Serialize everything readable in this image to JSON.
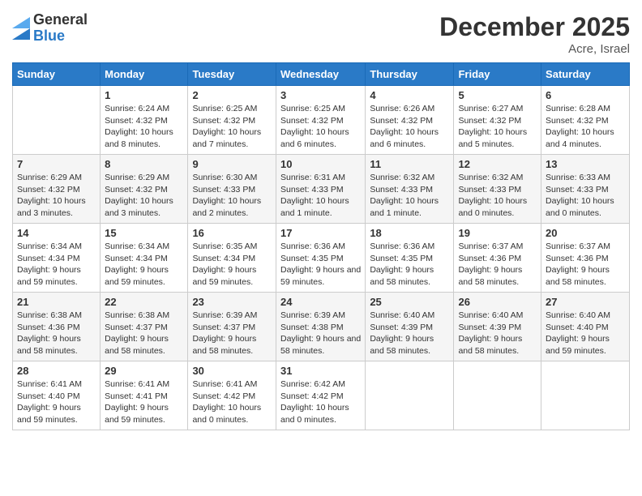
{
  "logo": {
    "general": "General",
    "blue": "Blue"
  },
  "header": {
    "month": "December 2025",
    "location": "Acre, Israel"
  },
  "days_of_week": [
    "Sunday",
    "Monday",
    "Tuesday",
    "Wednesday",
    "Thursday",
    "Friday",
    "Saturday"
  ],
  "weeks": [
    [
      {
        "day": "",
        "sunrise": "",
        "sunset": "",
        "daylight": ""
      },
      {
        "day": "1",
        "sunrise": "Sunrise: 6:24 AM",
        "sunset": "Sunset: 4:32 PM",
        "daylight": "Daylight: 10 hours and 8 minutes."
      },
      {
        "day": "2",
        "sunrise": "Sunrise: 6:25 AM",
        "sunset": "Sunset: 4:32 PM",
        "daylight": "Daylight: 10 hours and 7 minutes."
      },
      {
        "day": "3",
        "sunrise": "Sunrise: 6:25 AM",
        "sunset": "Sunset: 4:32 PM",
        "daylight": "Daylight: 10 hours and 6 minutes."
      },
      {
        "day": "4",
        "sunrise": "Sunrise: 6:26 AM",
        "sunset": "Sunset: 4:32 PM",
        "daylight": "Daylight: 10 hours and 6 minutes."
      },
      {
        "day": "5",
        "sunrise": "Sunrise: 6:27 AM",
        "sunset": "Sunset: 4:32 PM",
        "daylight": "Daylight: 10 hours and 5 minutes."
      },
      {
        "day": "6",
        "sunrise": "Sunrise: 6:28 AM",
        "sunset": "Sunset: 4:32 PM",
        "daylight": "Daylight: 10 hours and 4 minutes."
      }
    ],
    [
      {
        "day": "7",
        "sunrise": "Sunrise: 6:29 AM",
        "sunset": "Sunset: 4:32 PM",
        "daylight": "Daylight: 10 hours and 3 minutes."
      },
      {
        "day": "8",
        "sunrise": "Sunrise: 6:29 AM",
        "sunset": "Sunset: 4:32 PM",
        "daylight": "Daylight: 10 hours and 3 minutes."
      },
      {
        "day": "9",
        "sunrise": "Sunrise: 6:30 AM",
        "sunset": "Sunset: 4:33 PM",
        "daylight": "Daylight: 10 hours and 2 minutes."
      },
      {
        "day": "10",
        "sunrise": "Sunrise: 6:31 AM",
        "sunset": "Sunset: 4:33 PM",
        "daylight": "Daylight: 10 hours and 1 minute."
      },
      {
        "day": "11",
        "sunrise": "Sunrise: 6:32 AM",
        "sunset": "Sunset: 4:33 PM",
        "daylight": "Daylight: 10 hours and 1 minute."
      },
      {
        "day": "12",
        "sunrise": "Sunrise: 6:32 AM",
        "sunset": "Sunset: 4:33 PM",
        "daylight": "Daylight: 10 hours and 0 minutes."
      },
      {
        "day": "13",
        "sunrise": "Sunrise: 6:33 AM",
        "sunset": "Sunset: 4:33 PM",
        "daylight": "Daylight: 10 hours and 0 minutes."
      }
    ],
    [
      {
        "day": "14",
        "sunrise": "Sunrise: 6:34 AM",
        "sunset": "Sunset: 4:34 PM",
        "daylight": "Daylight: 9 hours and 59 minutes."
      },
      {
        "day": "15",
        "sunrise": "Sunrise: 6:34 AM",
        "sunset": "Sunset: 4:34 PM",
        "daylight": "Daylight: 9 hours and 59 minutes."
      },
      {
        "day": "16",
        "sunrise": "Sunrise: 6:35 AM",
        "sunset": "Sunset: 4:34 PM",
        "daylight": "Daylight: 9 hours and 59 minutes."
      },
      {
        "day": "17",
        "sunrise": "Sunrise: 6:36 AM",
        "sunset": "Sunset: 4:35 PM",
        "daylight": "Daylight: 9 hours and 59 minutes."
      },
      {
        "day": "18",
        "sunrise": "Sunrise: 6:36 AM",
        "sunset": "Sunset: 4:35 PM",
        "daylight": "Daylight: 9 hours and 58 minutes."
      },
      {
        "day": "19",
        "sunrise": "Sunrise: 6:37 AM",
        "sunset": "Sunset: 4:36 PM",
        "daylight": "Daylight: 9 hours and 58 minutes."
      },
      {
        "day": "20",
        "sunrise": "Sunrise: 6:37 AM",
        "sunset": "Sunset: 4:36 PM",
        "daylight": "Daylight: 9 hours and 58 minutes."
      }
    ],
    [
      {
        "day": "21",
        "sunrise": "Sunrise: 6:38 AM",
        "sunset": "Sunset: 4:36 PM",
        "daylight": "Daylight: 9 hours and 58 minutes."
      },
      {
        "day": "22",
        "sunrise": "Sunrise: 6:38 AM",
        "sunset": "Sunset: 4:37 PM",
        "daylight": "Daylight: 9 hours and 58 minutes."
      },
      {
        "day": "23",
        "sunrise": "Sunrise: 6:39 AM",
        "sunset": "Sunset: 4:37 PM",
        "daylight": "Daylight: 9 hours and 58 minutes."
      },
      {
        "day": "24",
        "sunrise": "Sunrise: 6:39 AM",
        "sunset": "Sunset: 4:38 PM",
        "daylight": "Daylight: 9 hours and 58 minutes."
      },
      {
        "day": "25",
        "sunrise": "Sunrise: 6:40 AM",
        "sunset": "Sunset: 4:39 PM",
        "daylight": "Daylight: 9 hours and 58 minutes."
      },
      {
        "day": "26",
        "sunrise": "Sunrise: 6:40 AM",
        "sunset": "Sunset: 4:39 PM",
        "daylight": "Daylight: 9 hours and 58 minutes."
      },
      {
        "day": "27",
        "sunrise": "Sunrise: 6:40 AM",
        "sunset": "Sunset: 4:40 PM",
        "daylight": "Daylight: 9 hours and 59 minutes."
      }
    ],
    [
      {
        "day": "28",
        "sunrise": "Sunrise: 6:41 AM",
        "sunset": "Sunset: 4:40 PM",
        "daylight": "Daylight: 9 hours and 59 minutes."
      },
      {
        "day": "29",
        "sunrise": "Sunrise: 6:41 AM",
        "sunset": "Sunset: 4:41 PM",
        "daylight": "Daylight: 9 hours and 59 minutes."
      },
      {
        "day": "30",
        "sunrise": "Sunrise: 6:41 AM",
        "sunset": "Sunset: 4:42 PM",
        "daylight": "Daylight: 10 hours and 0 minutes."
      },
      {
        "day": "31",
        "sunrise": "Sunrise: 6:42 AM",
        "sunset": "Sunset: 4:42 PM",
        "daylight": "Daylight: 10 hours and 0 minutes."
      },
      {
        "day": "",
        "sunrise": "",
        "sunset": "",
        "daylight": ""
      },
      {
        "day": "",
        "sunrise": "",
        "sunset": "",
        "daylight": ""
      },
      {
        "day": "",
        "sunrise": "",
        "sunset": "",
        "daylight": ""
      }
    ]
  ]
}
